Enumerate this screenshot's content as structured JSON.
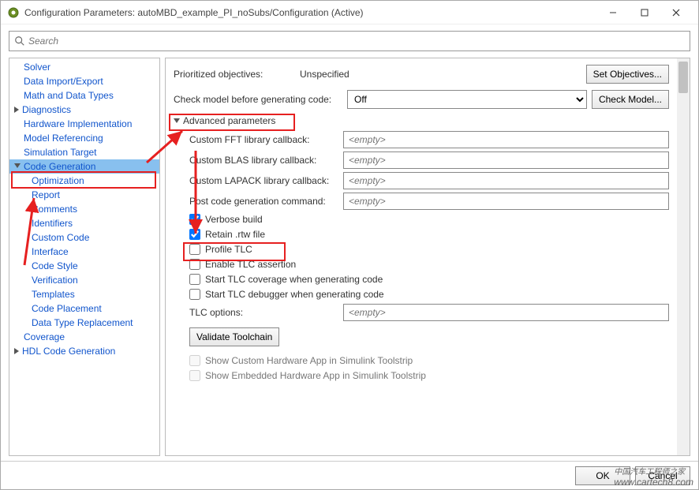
{
  "window": {
    "title": "Configuration Parameters: autoMBD_example_PI_noSubs/Configuration (Active)"
  },
  "search": {
    "placeholder": "Search"
  },
  "sidebar": {
    "items": [
      {
        "label": "Solver"
      },
      {
        "label": "Data Import/Export"
      },
      {
        "label": "Math and Data Types"
      },
      {
        "label": "Diagnostics"
      },
      {
        "label": "Hardware Implementation"
      },
      {
        "label": "Model Referencing"
      },
      {
        "label": "Simulation Target"
      },
      {
        "label": "Code Generation"
      },
      {
        "label": "Optimization"
      },
      {
        "label": "Report"
      },
      {
        "label": "Comments"
      },
      {
        "label": "Identifiers"
      },
      {
        "label": "Custom Code"
      },
      {
        "label": "Interface"
      },
      {
        "label": "Code Style"
      },
      {
        "label": "Verification"
      },
      {
        "label": "Templates"
      },
      {
        "label": "Code Placement"
      },
      {
        "label": "Data Type Replacement"
      },
      {
        "label": "Coverage"
      },
      {
        "label": "HDL Code Generation"
      }
    ]
  },
  "main": {
    "objectives_label": "Prioritized objectives:",
    "objectives_value": "Unspecified",
    "set_objectives_btn": "Set Objectives...",
    "check_label": "Check model before generating code:",
    "check_value": "Off",
    "check_btn": "Check Model...",
    "section": "Advanced parameters",
    "fields": {
      "fft_label": "Custom FFT library callback:",
      "blas_label": "Custom BLAS library callback:",
      "lapack_label": "Custom LAPACK library callback:",
      "postcode_label": "Post code generation command:",
      "tlc_label": "TLC options:",
      "empty_ph": "<empty>"
    },
    "checks": {
      "verbose": "Verbose build",
      "retain": "Retain .rtw file",
      "profile": "Profile TLC",
      "enable_tlc": "Enable TLC assertion",
      "tlc_cov": "Start TLC coverage when generating code",
      "tlc_dbg": "Start TLC debugger when generating code",
      "show_custom": "Show Custom Hardware App in Simulink Toolstrip",
      "show_embed": "Show Embedded Hardware App in Simulink Toolstrip"
    },
    "validate_btn": "Validate Toolchain"
  },
  "footer": {
    "ok": "OK",
    "cancel": "Cancel"
  },
  "watermark": {
    "cn": "中国汽车工程师之家",
    "url": "www.cartech8.com"
  }
}
